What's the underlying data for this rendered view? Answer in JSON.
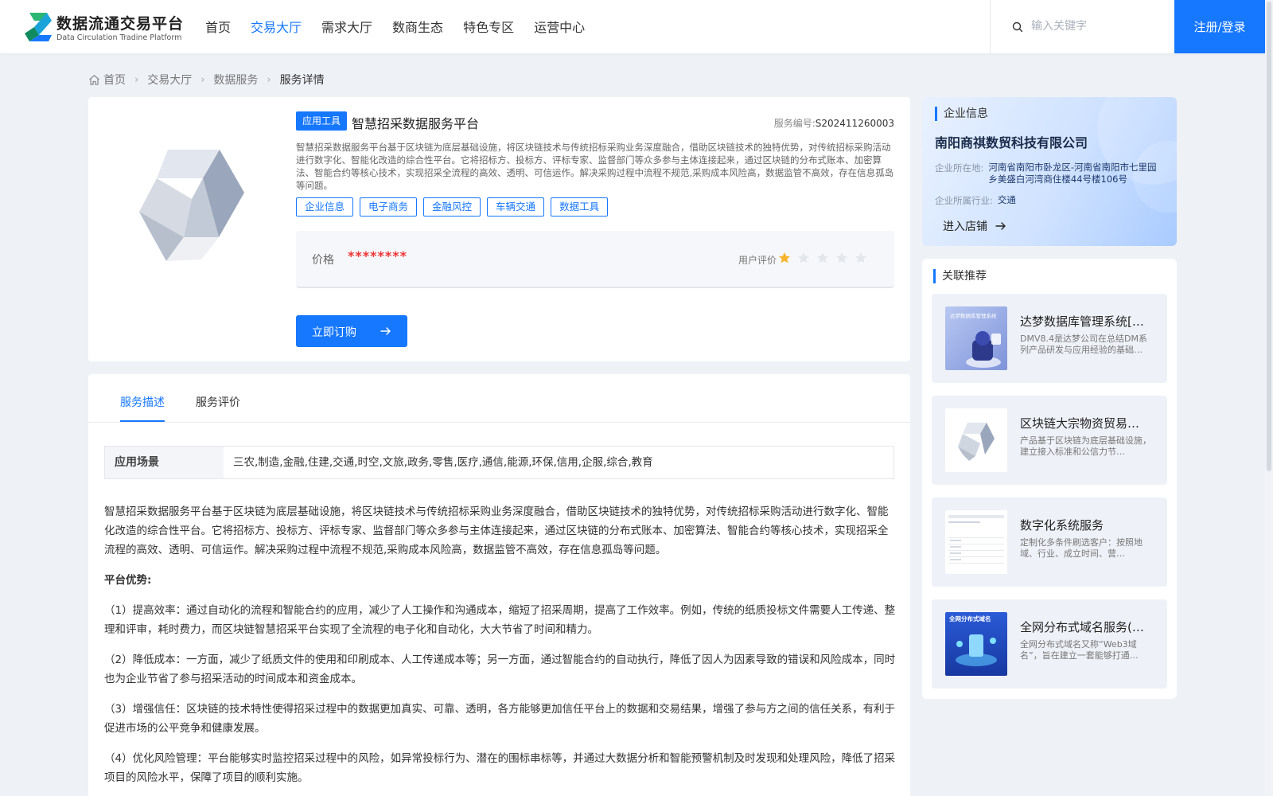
{
  "header": {
    "logo_cn": "数据流通交易平台",
    "logo_en": "Data Circulation Tradine Platform",
    "nav": [
      {
        "label": "首页",
        "active": false
      },
      {
        "label": "交易大厅",
        "active": true
      },
      {
        "label": "需求大厅",
        "active": false
      },
      {
        "label": "数商生态",
        "active": false
      },
      {
        "label": "特色专区",
        "active": false
      },
      {
        "label": "运营中心",
        "active": false
      }
    ],
    "search_placeholder": "输入关键字",
    "login_label": "注册/登录"
  },
  "breadcrumb": {
    "home": "首页",
    "level1": "交易大厅",
    "level2": "数据服务",
    "current": "服务详情"
  },
  "product": {
    "type_tag": "应用工具",
    "title": "智慧招采数据服务平台",
    "service_no_label": "服务编号:",
    "service_no": "S202411260003",
    "description": "智慧招采数据服务平台基于区块链为底层基础设施，将区块链技术与传统招标采购业务深度融合，借助区块链技术的独特优势，对传统招标采购活动进行数字化、智能化改造的综合性平台。它将招标方、投标方、评标专家、监督部门等众多参与主体连接起来，通过区块链的分布式账本、加密算法、智能合约等核心技术，实现招采全流程的高效、透明、可信运作。解决采购过程中流程不规范,采购成本风险高，数据监管不高效，存在信息孤岛等问题。",
    "tags": [
      "企业信息",
      "电子商务",
      "金融风控",
      "车辆交通",
      "数据工具"
    ],
    "price_label": "价格",
    "price_value": "********",
    "rating_label": "用户评价",
    "rating": 1,
    "rating_max": 5,
    "order_label": "立即订购"
  },
  "detail": {
    "tabs": [
      {
        "label": "服务描述",
        "active": true
      },
      {
        "label": "服务评价",
        "active": false
      }
    ],
    "scene_label": "应用场景",
    "scene_value": "三农,制造,金融,住建,交通,时空,文旅,政务,零售,医疗,通信,能源,环保,信用,企服,综合,教育",
    "paragraph_intro": "智慧招采数据服务平台基于区块链为底层基础设施，将区块链技术与传统招标采购业务深度融合，借助区块链技术的独特优势，对传统招标采购活动进行数字化、智能化改造的综合性平台。它将招标方、投标方、评标专家、监督部门等众多参与主体连接起来，通过区块链的分布式账本、加密算法、智能合约等核心技术，实现招采全流程的高效、透明、可信运作。解决采购过程中流程不规范,采购成本风险高，数据监管不高效，存在信息孤岛等问题。",
    "advantage_heading": "平台优势:",
    "advantage_1": "（1）提高效率：通过自动化的流程和智能合约的应用，减少了人工操作和沟通成本，缩短了招采周期，提高了工作效率。例如，传统的纸质投标文件需要人工传递、整理和评审，耗时费力，而区块链智慧招采平台实现了全流程的电子化和自动化，大大节省了时间和精力。",
    "advantage_2": "（2）降低成本：一方面，减少了纸质文件的使用和印刷成本、人工传递成本等；另一方面，通过智能合约的自动执行，降低了因人为因素导致的错误和风险成本，同时也为企业节省了参与招采活动的时间成本和资金成本。",
    "advantage_3": "（3）增强信任：区块链的技术特性使得招采过程中的数据更加真实、可靠、透明，各方能够更加信任平台上的数据和交易结果，增强了参与方之间的信任关系，有利于促进市场的公平竞争和健康发展。",
    "advantage_4": "（4）优化风险管理：平台能够实时监控招采过程中的风险，如异常投标行为、潜在的围标串标等，并通过大数据分析和智能预警机制及时发现和处理风险，降低了招采项目的风险水平，保障了项目的顺利实施。"
  },
  "company": {
    "section_title": "企业信息",
    "name": "南阳商祺数贸科技有限公司",
    "location_label": "企业所在地:",
    "location": "河南省南阳市卧龙区-河南省南阳市七里园乡美盛白河湾商住楼44号楼106号",
    "industry_label": "企业所属行业:",
    "industry": "交通",
    "enter_label": "进入店铺"
  },
  "recommend": {
    "section_title": "关联推荐",
    "items": [
      {
        "title": "达梦数据库管理系统[…",
        "desc": "DMV8.4是达梦公司在总结DM系列产品研发与应用经验的基础…",
        "thumb_text": "达梦数据库管理系统"
      },
      {
        "title": "区块链大宗物资贸易…",
        "desc": "产品基于区块链为底层基础设施，建立接入标准和公信力节…",
        "thumb_text": ""
      },
      {
        "title": "数字化系统服务",
        "desc": "定制化多条件刷选客户：按照地域、行业、成立时间、营…",
        "thumb_text": ""
      },
      {
        "title": "全网分布式域名服务(…",
        "desc": "全网分布式域名又称“Web3域名”，旨在建立一套能够打通…",
        "thumb_text": "全网分布式域名"
      }
    ]
  },
  "colors": {
    "primary": "#1677ff",
    "price": "#ee3333",
    "star_active": "#f7b42c",
    "star_inactive": "#e3e6ea"
  }
}
